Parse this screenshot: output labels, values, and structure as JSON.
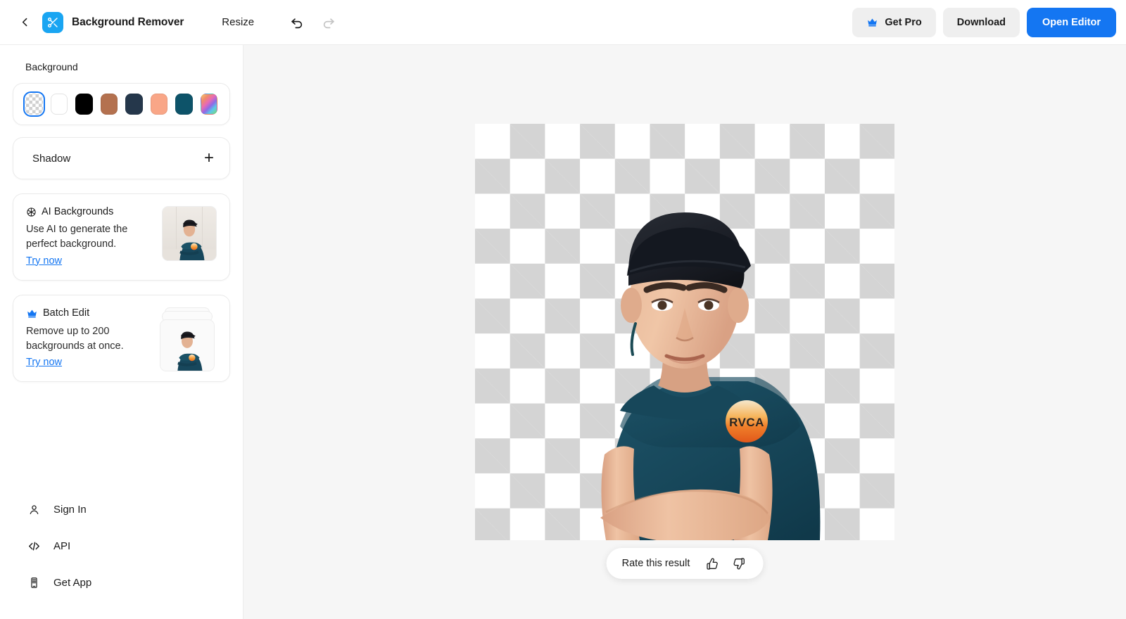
{
  "header": {
    "back_icon": "chevron-left-icon",
    "logo_icon": "scissors-logo-icon",
    "title": "Background Remover",
    "resize_label": "Resize",
    "undo_icon": "undo-arrow-icon",
    "redo_icon": "redo-arrow-icon",
    "get_pro_label": "Get Pro",
    "get_pro_icon": "crown-icon",
    "download_label": "Download",
    "open_editor_label": "Open Editor",
    "primary_color": "#1476F2",
    "logo_color": "#19A5F2"
  },
  "sidebar": {
    "background_section_label": "Background",
    "swatches": [
      {
        "name": "transparent",
        "color": "transparent",
        "selected": true
      },
      {
        "name": "white",
        "color": "#ffffff",
        "selected": false
      },
      {
        "name": "black",
        "color": "#000000",
        "selected": false
      },
      {
        "name": "brown",
        "color": "#b4714f",
        "selected": false
      },
      {
        "name": "navy",
        "color": "#25374b",
        "selected": false
      },
      {
        "name": "peach",
        "color": "#f9a687",
        "selected": false
      },
      {
        "name": "teal",
        "color": "#0d5369",
        "selected": false
      },
      {
        "name": "gradient",
        "color": "rainbow",
        "selected": false
      }
    ],
    "shadow": {
      "label": "Shadow",
      "add_icon": "plus-icon"
    },
    "promos": [
      {
        "icon": "aperture-icon",
        "title": "AI Backgrounds",
        "description": "Use AI to generate the perfect background.",
        "link_label": "Try now",
        "thumb": "person-studio-thumbnail"
      },
      {
        "icon": "crown-icon",
        "title": "Batch Edit",
        "description": "Remove up to 200 backgrounds at once.",
        "link_label": "Try now",
        "thumb": "person-stacked-thumbnail"
      }
    ],
    "nav": [
      {
        "icon": "user-icon",
        "label": "Sign In"
      },
      {
        "icon": "code-brackets-icon",
        "label": "API"
      },
      {
        "icon": "mobile-phone-icon",
        "label": "Get App"
      }
    ]
  },
  "canvas": {
    "background_style": "transparent-checkerboard",
    "subject_alt": "young-man-wearing-cap-and-teal-sleeveless-shirt",
    "shirt_logo_text": "RVCA",
    "rate": {
      "label": "Rate this result",
      "thumbs_up_icon": "thumbs-up-icon",
      "thumbs_down_icon": "thumbs-down-icon"
    }
  }
}
